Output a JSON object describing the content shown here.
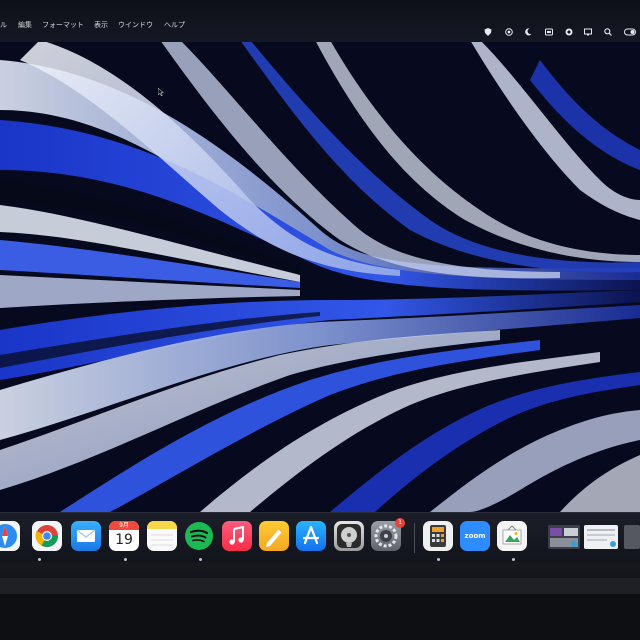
{
  "menubar": {
    "items": [
      {
        "label": "ル"
      },
      {
        "label": "編集"
      },
      {
        "label": "フォーマット"
      },
      {
        "label": "表示"
      },
      {
        "label": "ウインドウ"
      },
      {
        "label": "ヘルプ"
      }
    ],
    "status_icons": [
      "shield-icon",
      "record-icon",
      "moon-icon",
      "control-icon",
      "vpn-icon",
      "display-icon",
      "cloud-icon",
      "notes-icon",
      "search-icon",
      "toggle-icon"
    ]
  },
  "dock": {
    "apps": [
      {
        "name": "safari",
        "icon": "safari-icon"
      },
      {
        "name": "chrome",
        "icon": "chrome-icon"
      },
      {
        "name": "mail",
        "icon": "mail-icon"
      },
      {
        "name": "calendar",
        "icon": "calendar-icon",
        "month": "9月",
        "day": "19"
      },
      {
        "name": "notes",
        "icon": "notes-icon"
      },
      {
        "name": "spotify",
        "icon": "spotify-icon"
      },
      {
        "name": "music",
        "icon": "music-icon"
      },
      {
        "name": "pages",
        "icon": "pages-icon"
      },
      {
        "name": "app-store",
        "icon": "app-store-icon"
      },
      {
        "name": "disk-utility",
        "icon": "disk-utility-icon"
      },
      {
        "name": "system-settings",
        "icon": "gear-icon",
        "badge": "1"
      },
      {
        "name": "calculator",
        "icon": "calculator-icon"
      },
      {
        "name": "zoom",
        "icon": "zoom-icon",
        "label": "zoom"
      },
      {
        "name": "preview",
        "icon": "preview-icon"
      },
      {
        "name": "window-thumbnail-1",
        "icon": "window-thumbnail"
      },
      {
        "name": "window-thumbnail-2",
        "icon": "window-thumbnail"
      }
    ]
  },
  "colors": {
    "accent_blue": "#2a4fd6",
    "spotify_green": "#1db954",
    "music_red": "#fa2d48",
    "badge_red": "#e5443a"
  }
}
